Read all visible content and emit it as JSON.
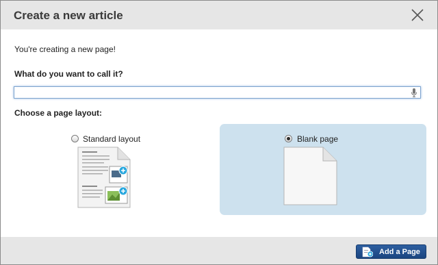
{
  "dialog": {
    "title": "Create a new article",
    "intro": "You're creating a new page!",
    "name_label": "What do you want to call it?",
    "name_value": "",
    "layout_label": "Choose a page layout:"
  },
  "layouts": [
    {
      "label": "Standard layout",
      "selected": false
    },
    {
      "label": "Blank page",
      "selected": true
    }
  ],
  "footer": {
    "add_button_label": "Add a Page"
  },
  "colors": {
    "header_bg": "#e6e6e6",
    "selected_option_bg": "#cde1ee",
    "button_bg": "#1f4c88"
  }
}
